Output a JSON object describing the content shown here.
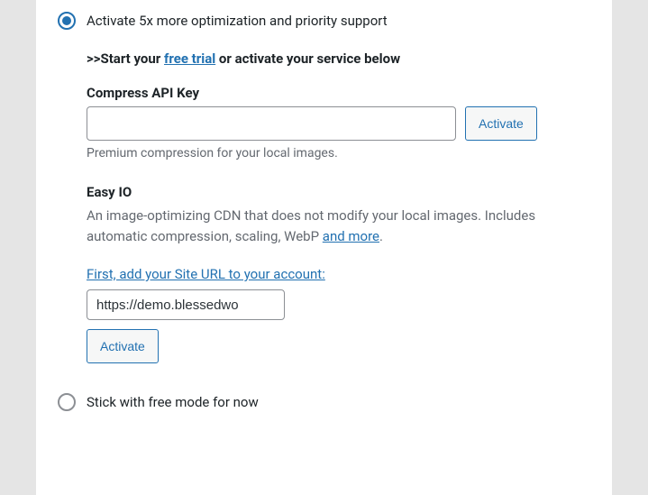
{
  "options": {
    "premium": {
      "label": "Activate 5x more optimization and priority support",
      "start_line_prefix": ">>Start your ",
      "start_line_link": "free trial",
      "start_line_suffix": " or activate your service below",
      "compress": {
        "heading": "Compress API Key",
        "input_value": "",
        "activate_label": "Activate",
        "helper": "Premium compression for your local images."
      },
      "easyio": {
        "heading": "Easy IO",
        "description_prefix": "An image-optimizing CDN that does not modify your local images. Includes automatic compression, scaling, WebP ",
        "description_link": "and more",
        "description_suffix": ".",
        "add_url_link": "First, add your Site URL to your account:",
        "site_url_value": "https://demo.blessedwo",
        "activate_label": "Activate"
      }
    },
    "free": {
      "label": "Stick with free mode for now"
    }
  }
}
